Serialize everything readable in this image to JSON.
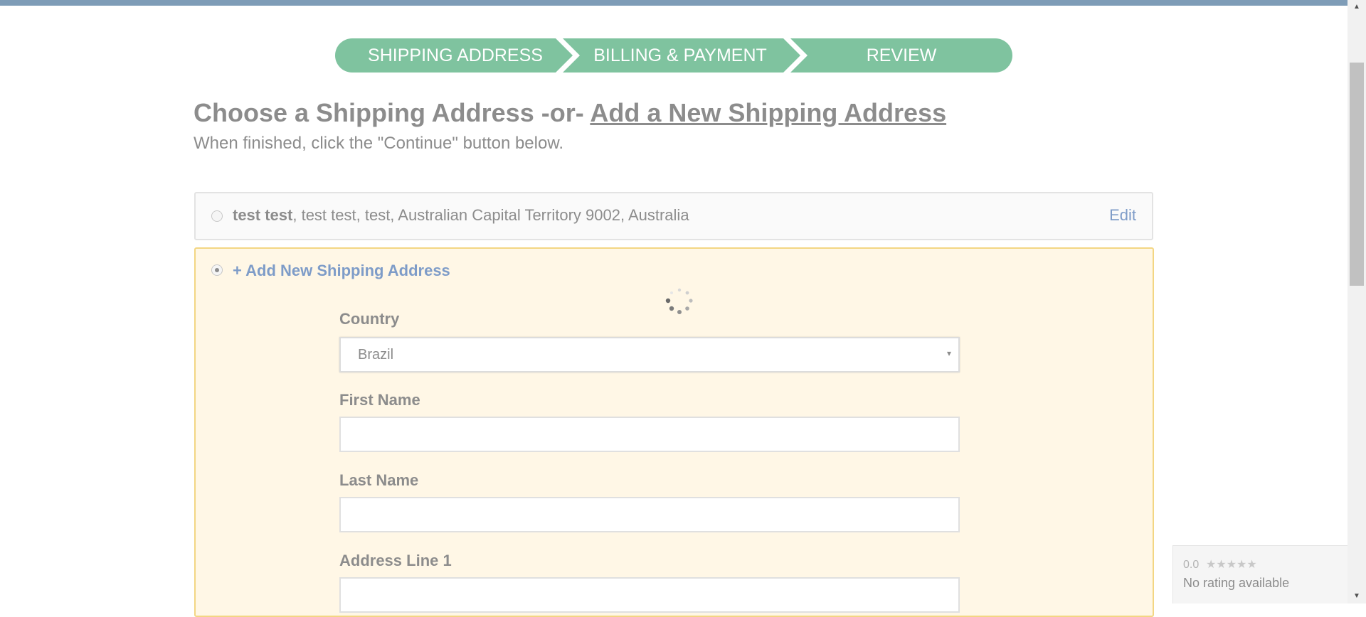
{
  "steps": [
    {
      "label": "SHIPPING ADDRESS"
    },
    {
      "label": "BILLING & PAYMENT"
    },
    {
      "label": "REVIEW"
    }
  ],
  "colors": {
    "step_fill": "#7fc39f",
    "top_bar": "#7e9cb7",
    "link": "#7e9cc8",
    "new_card_bg": "#fff7e6",
    "new_card_border": "#f3d683"
  },
  "heading": {
    "prefix": "Choose a Shipping Address -or- ",
    "link": "Add a New Shipping Address"
  },
  "subheading": "When finished, click the \"Continue\" button below.",
  "existing_address": {
    "name": "test test",
    "details": ", test test, test, Australian Capital Territory 9002, Australia",
    "edit_label": "Edit"
  },
  "new_address": {
    "title": "+ Add New Shipping Address",
    "fields": {
      "country_label": "Country",
      "country_value": "Brazil",
      "first_name_label": "First Name",
      "first_name_value": "",
      "last_name_label": "Last Name",
      "last_name_value": "",
      "address1_label": "Address Line 1",
      "address1_value": ""
    }
  },
  "rating": {
    "score": "0.0",
    "stars": "★★★★★",
    "text": "No rating available"
  },
  "icons": {
    "spinner": "loading-spinner-icon",
    "scroll_up": "▲",
    "scroll_down": "▼",
    "select_caret": "▾"
  }
}
